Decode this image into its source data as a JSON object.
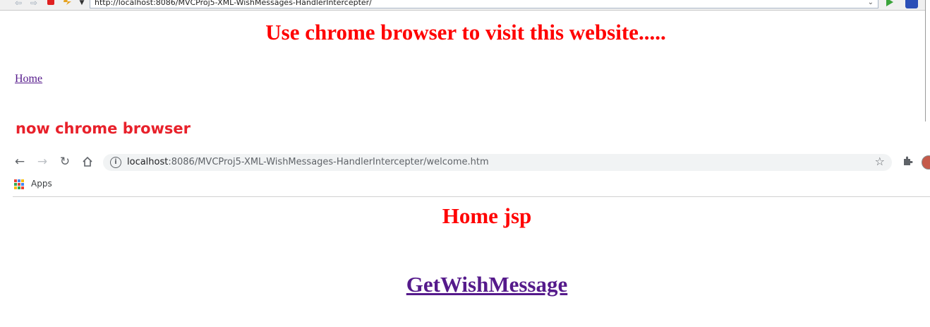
{
  "old_browser": {
    "address_url": "http://localhost:8086/MVCProj5-XML-WishMessages-HandlerIntercepter/",
    "heading": "Use chrome browser to visit this website.....",
    "home_link": "Home",
    "toolbar_icons": [
      "back-arrow-icon",
      "forward-arrow-icon",
      "stop-icon",
      "compatibility-icon",
      "dropdown-icon",
      "go-icon",
      "tab-icon"
    ]
  },
  "caption": "now chrome browser",
  "chrome": {
    "url_host": "localhost",
    "url_path": ":8086/MVCProj5-XML-WishMessages-HandlerIntercepter/welcome.htm",
    "bookmarks": [
      {
        "label": "Apps",
        "icon": "apps-grid-icon"
      }
    ],
    "heading": "Home jsp",
    "link_text": "GetWishMessage",
    "nav_icons": [
      "back-icon",
      "forward-icon",
      "reload-icon",
      "home-icon",
      "info-icon",
      "star-icon",
      "extensions-icon",
      "profile-avatar"
    ]
  },
  "colors": {
    "heading_red": "#ff0000",
    "caption_red": "#e8212b",
    "visited_link": "#551a8b"
  }
}
